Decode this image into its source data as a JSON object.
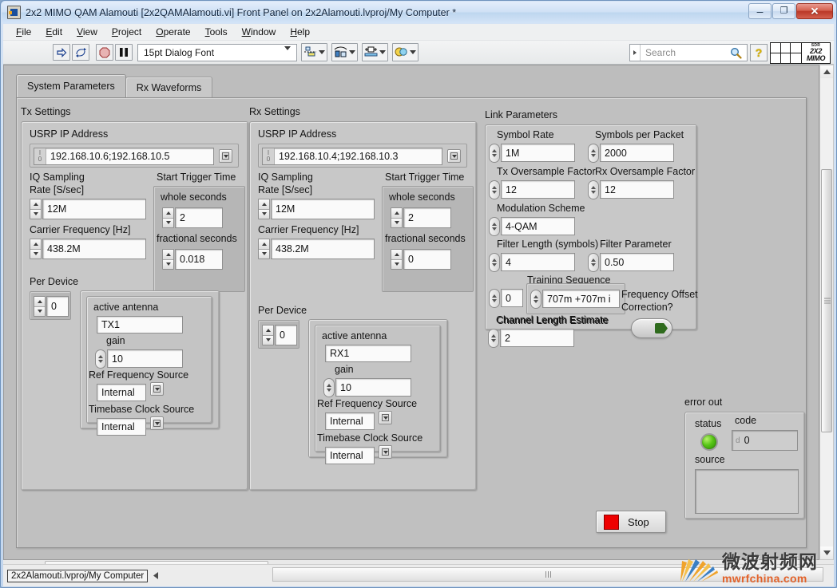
{
  "window": {
    "title": "2x2 MIMO QAM Alamouti [2x2QAMAlamouti.vi] Front Panel on 2x2Alamouti.lvproj/My Computer *",
    "icon": "labview-vi-icon",
    "minimize": "–",
    "maximize": "❐",
    "close": "✕"
  },
  "menu": {
    "items": [
      {
        "first": "F",
        "rest": "ile"
      },
      {
        "first": "E",
        "rest": "dit"
      },
      {
        "first": "V",
        "rest": "iew"
      },
      {
        "first": "P",
        "rest": "roject"
      },
      {
        "first": "O",
        "rest": "perate"
      },
      {
        "first": "T",
        "rest": "ools"
      },
      {
        "first": "W",
        "rest": "indow"
      },
      {
        "first": "H",
        "rest": "elp"
      }
    ]
  },
  "toolbar": {
    "run_icon": "run-arrow-icon",
    "run_continuous_icon": "run-continuously-icon",
    "abort_icon": "abort-execution-icon",
    "pause_icon": "pause-icon",
    "font_value": "15pt Dialog Font",
    "align_icon": "align-objects-icon",
    "distribute_icon": "distribute-objects-icon",
    "resize_icon": "resize-objects-icon",
    "reorder_icon": "reorder-objects-icon",
    "search_placeholder": "Search",
    "search_icon": "search-magnifier-icon",
    "help_icon": "context-help-icon",
    "logo": {
      "small": "SDR",
      "line1": "2X2",
      "line2": "MIMO"
    }
  },
  "tabs": [
    {
      "label": "System Parameters",
      "active": true
    },
    {
      "label": "Rx Waveforms",
      "active": false
    }
  ],
  "tx": {
    "section_label": "Tx Settings",
    "usrp_ip_label": "USRP IP Address",
    "usrp_ip_value": "192.168.10.6;192.168.10.5",
    "iq_rate_label_line1": "IQ Sampling",
    "iq_rate_label_line2": "Rate [S/sec]",
    "iq_rate_value": "12M",
    "carrier_label": "Carrier Frequency [Hz]",
    "carrier_value": "438.2M",
    "trigger_label": "Start Trigger Time",
    "whole_seconds_label": "whole seconds",
    "whole_seconds_value": "2",
    "fractional_seconds_label": "fractional seconds",
    "fractional_seconds_value": "0.018",
    "per_device_label": "Per Device",
    "per_device_value": "0",
    "active_antenna_label": "active antenna",
    "active_antenna_value": "TX1",
    "gain_label": "gain",
    "gain_value": "10",
    "ref_freq_label": "Ref Frequency Source",
    "ref_freq_value": "Internal",
    "timebase_label": "Timebase Clock Source",
    "timebase_value": "Internal"
  },
  "rx": {
    "section_label": "Rx Settings",
    "usrp_ip_label": "USRP IP Address",
    "usrp_ip_value": "192.168.10.4;192.168.10.3",
    "iq_rate_label_line1": "IQ Sampling",
    "iq_rate_label_line2": "Rate [S/sec]",
    "iq_rate_value": "12M",
    "carrier_label": "Carrier Frequency [Hz]",
    "carrier_value": "438.2M",
    "trigger_label": "Start Trigger Time",
    "whole_seconds_label": "whole seconds",
    "whole_seconds_value": "2",
    "fractional_seconds_label": "fractional seconds",
    "fractional_seconds_value": "0",
    "per_device_label": "Per Device",
    "per_device_value": "0",
    "active_antenna_label": "active antenna",
    "active_antenna_value": "RX1",
    "gain_label": "gain",
    "gain_value": "10",
    "ref_freq_label": "Ref Frequency Source",
    "ref_freq_value": "Internal",
    "timebase_label": "Timebase Clock Source",
    "timebase_value": "Internal"
  },
  "link": {
    "section_label": "Link Parameters",
    "symbol_rate_label": "Symbol Rate",
    "symbol_rate_value": "1M",
    "symbols_per_packet_label": "Symbols per Packet",
    "symbols_per_packet_value": "2000",
    "tx_oversample_label": "Tx Oversample Factor",
    "tx_oversample_value": "12",
    "rx_oversample_label": "Rx Oversample Factor",
    "rx_oversample_value": "12",
    "modulation_label": "Modulation Scheme",
    "modulation_value": "4-QAM",
    "filter_length_label": "Filter Length (symbols)",
    "filter_length_value": "4",
    "filter_param_label": "Filter Parameter",
    "filter_param_value": "0.50",
    "training_seq_label": "Training Sequence",
    "training_seq_index": "0",
    "training_seq_value": "707m +707m i",
    "channel_len_label": "Channel Length Estimate",
    "channel_len_value": "2",
    "freq_offset_label_line1": "Frequency Offset",
    "freq_offset_label_line2": "Correction?",
    "freq_offset_state": "on"
  },
  "error_out": {
    "label": "error out",
    "status_label": "status",
    "status_state": "ok",
    "code_label": "code",
    "code_prefix": "d",
    "code_value": "0",
    "source_label": "source",
    "source_value": ""
  },
  "stop_button": {
    "label": "Stop",
    "color": "#ee0000"
  },
  "status_bar": {
    "path": "2x2Alamouti.lvproj/My Computer",
    "caret": "◄"
  },
  "watermark": {
    "cn": "微波射频网",
    "en": "mwrfchina.com"
  },
  "colors": {
    "panel_gray": "#bdbdbd",
    "cluster_gray": "#c8c8c8",
    "led_green": "#56c516",
    "stop_red": "#ee0000",
    "title_blue": "#cfe1f5"
  }
}
